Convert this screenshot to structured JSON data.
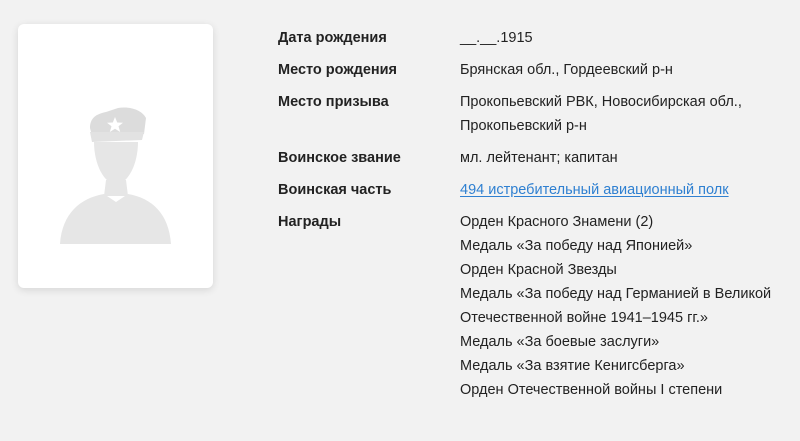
{
  "profile": {
    "birth_date": {
      "label": "Дата рождения",
      "value": "__.__.1915"
    },
    "birth_place": {
      "label": "Место рождения",
      "value": "Брянская обл., Гордеевский р-н"
    },
    "draft_place": {
      "label": "Место призыва",
      "lines": [
        "Прокопьевский РВК, Новосибирская обл.,",
        "Прокопьевский р-н"
      ]
    },
    "rank": {
      "label": "Воинское звание",
      "value": "мл. лейтенант; капитан"
    },
    "unit": {
      "label": "Воинская часть",
      "value": "494 истребительный авиационный полк"
    },
    "awards": {
      "label": "Награды",
      "items": [
        "Орден Красного Знамени (2)",
        "Медаль «За победу над Японией»",
        "Орден Красной Звезды",
        "Медаль «За победу над Германией в Великой",
        "Отечественной войне 1941–1945 гг.»",
        "Медаль «За боевые заслуги»",
        "Медаль «За взятие Кенигсберга»",
        "Орден Отечественной войны I степени"
      ]
    }
  },
  "colors": {
    "background": "#f2f2f2",
    "card": "#ffffff",
    "silhouette": "#e6e6e6",
    "star": "#ffffff",
    "link": "#2f80d1",
    "text": "#222222"
  }
}
